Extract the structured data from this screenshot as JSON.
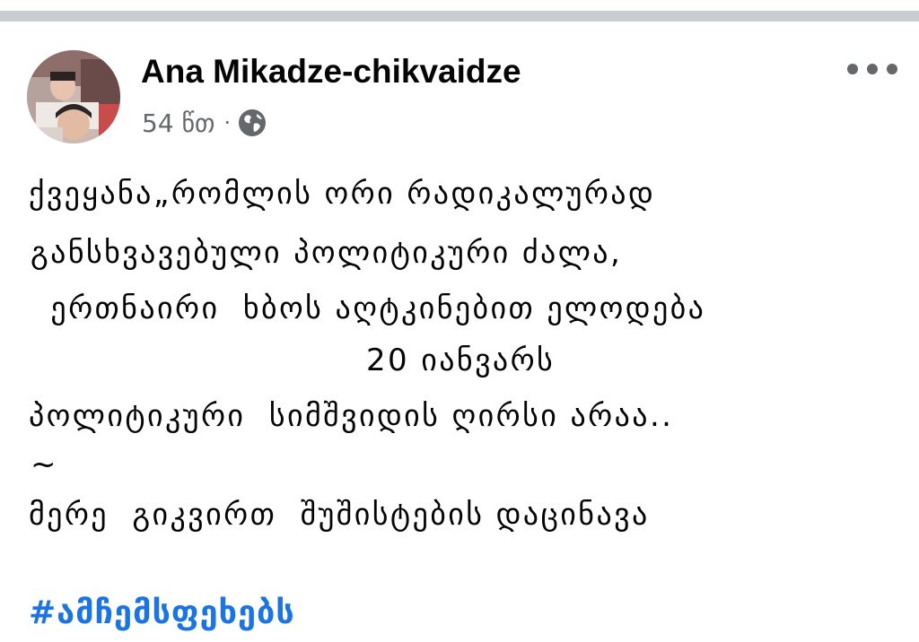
{
  "post": {
    "author": "Ana Mikadze-chikvaidze",
    "timestamp": "54 წთ",
    "separator": "·",
    "privacy_icon": "globe-icon",
    "menu_icon": "more-options-icon",
    "lines": [
      "ქვეყანა„რომლის ორი რადიკალურად",
      "განსხვავებული პოლიტიკური ძალა,",
      "  ერთნაირი  ხბოს აღტკინებით ელოდება",
      "20 იანვარს",
      "პოლიტიკური  სიმშვიდის ღირსი არაა..",
      "~",
      "მერე  გიკვირთ  შუშისტების დაცინავა"
    ],
    "hashtag": "#ამჩემსფეხებს"
  },
  "colors": {
    "divider": "#c9ccd1",
    "text": "#050505",
    "secondary": "#65676b",
    "link": "#1b74e4"
  }
}
